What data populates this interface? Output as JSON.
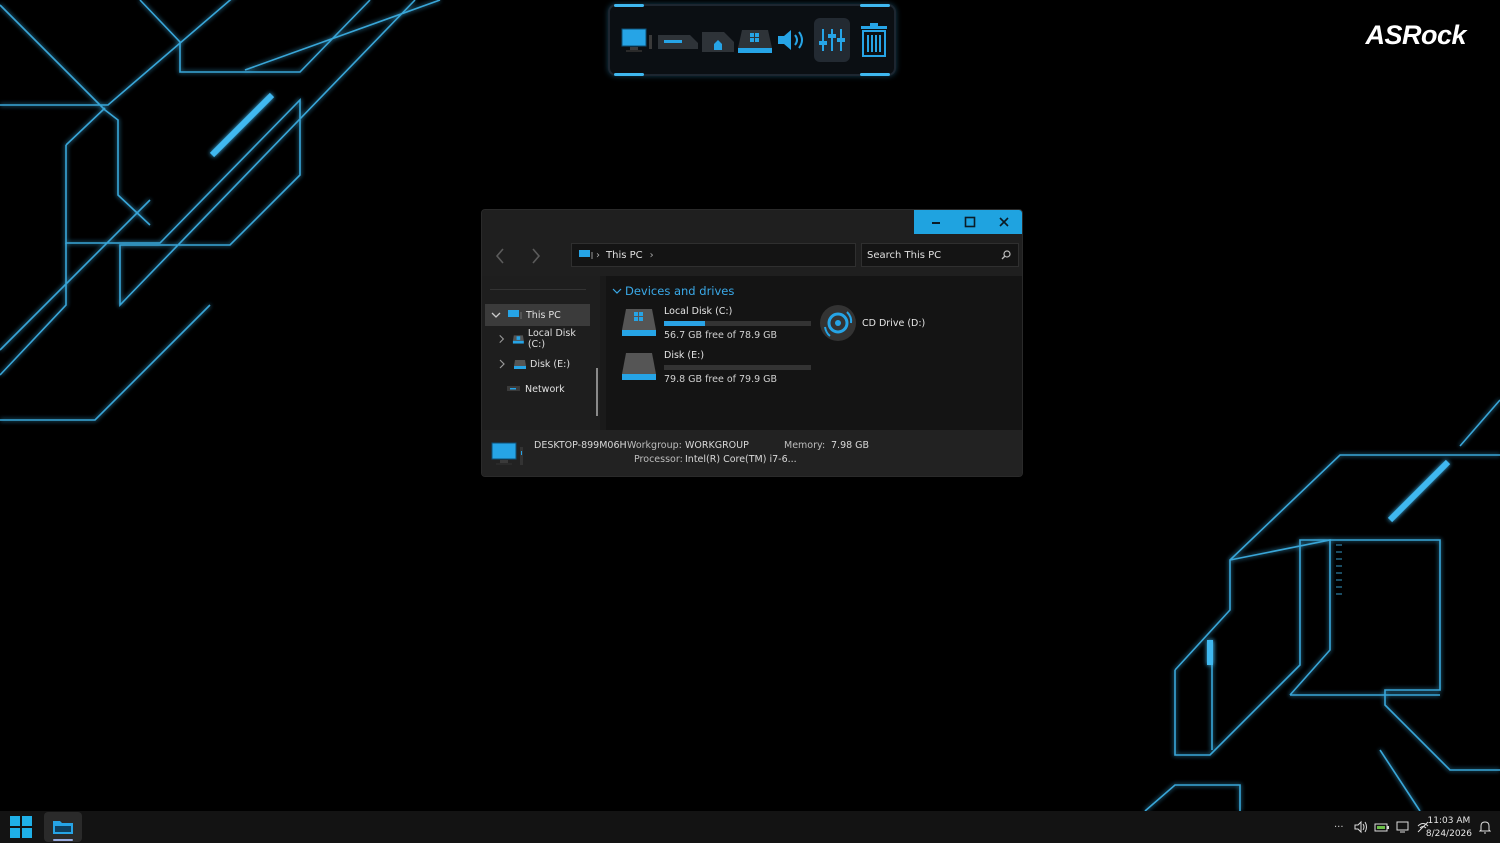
{
  "wallpaper": {
    "brand": "ASRock",
    "accent": "#3fb8f0"
  },
  "dock": {
    "items": [
      "monitor-icon",
      "pc-tower-icon",
      "network-icon",
      "drive-icon",
      "speaker-icon",
      "mixer-icon",
      "trash-icon"
    ]
  },
  "window": {
    "caption": {
      "minimize": "minimize-icon",
      "maximize": "maximize-icon",
      "close": "close-icon"
    },
    "address": {
      "crumb": "This PC"
    },
    "search": {
      "placeholder": "Search This PC"
    },
    "sidebar": {
      "items": [
        {
          "label": "This PC",
          "icon": "monitor-icon",
          "active": true
        },
        {
          "label": "Local Disk (C:)",
          "icon": "drive-icon"
        },
        {
          "label": "Disk (E:)",
          "icon": "drive-icon"
        },
        {
          "label": "Network",
          "icon": "network-icon"
        }
      ]
    },
    "content": {
      "group": "Devices and drives",
      "drives": [
        {
          "name": "Local Disk (C:)",
          "free": "56.7 GB free of 78.9 GB",
          "used_fraction": 0.28
        },
        {
          "name": "Disk (E:)",
          "free": "79.8 GB free of 79.9 GB",
          "used_fraction": 0.0
        },
        {
          "name": "CD Drive (D:)"
        }
      ]
    },
    "details": {
      "computer_name": "DESKTOP-899M06H",
      "workgroup_label": "Workgroup:",
      "workgroup": "WORKGROUP",
      "memory_label": "Memory:",
      "memory": "7.98 GB",
      "processor_label": "Processor:",
      "processor": "Intel(R) Core(TM) i7-6..."
    }
  },
  "taskbar": {
    "tray_overflow": "···",
    "time": "11:03 AM",
    "date": "8/24/2026"
  }
}
